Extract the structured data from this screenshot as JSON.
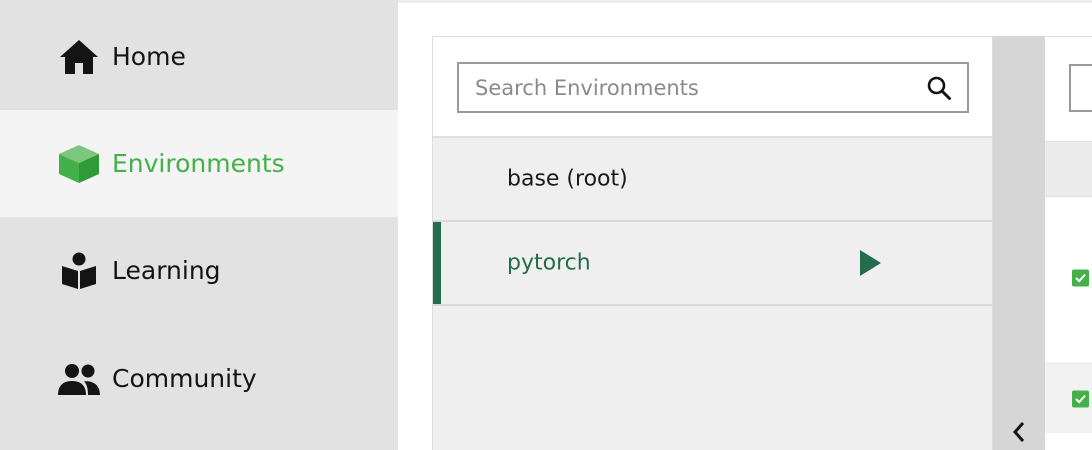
{
  "sidebar": {
    "items": [
      {
        "label": "Home",
        "icon": "home-icon",
        "active": false
      },
      {
        "label": "Environments",
        "icon": "cube-icon",
        "active": true
      },
      {
        "label": "Learning",
        "icon": "book-reader-icon",
        "active": false
      },
      {
        "label": "Community",
        "icon": "people-icon",
        "active": false
      }
    ]
  },
  "environments": {
    "search": {
      "placeholder": "Search Environments",
      "value": ""
    },
    "items": [
      {
        "name": "base (root)",
        "selected": false
      },
      {
        "name": "pytorch",
        "selected": true
      }
    ]
  },
  "packages": {
    "rows": [
      {
        "checked": true
      },
      {
        "checked": true
      }
    ]
  },
  "colors": {
    "accent_green": "#43b049",
    "selected_env": "#256b4e",
    "sidebar_bg": "#e2e2e2",
    "sidebar_active_bg": "#f4f4f4"
  }
}
